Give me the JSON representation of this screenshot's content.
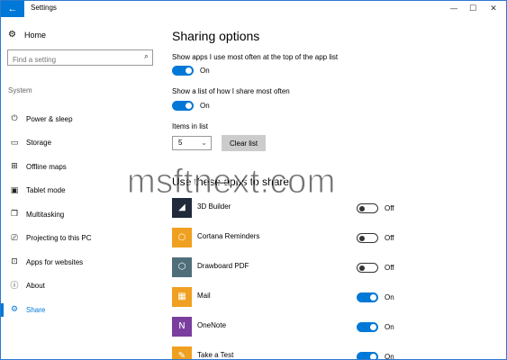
{
  "window": {
    "title": "Settings",
    "back_glyph": "←",
    "minimize_glyph": "—",
    "maximize_glyph": "☐",
    "close_glyph": "✕"
  },
  "sidebar": {
    "home_label": "Home",
    "search_placeholder": "Find a setting",
    "section_label": "System",
    "items": [
      {
        "label": "Power & sleep",
        "icon": "power-icon",
        "glyph": "⏻"
      },
      {
        "label": "Storage",
        "icon": "storage-icon",
        "glyph": "▭"
      },
      {
        "label": "Offline maps",
        "icon": "map-icon",
        "glyph": "⊞"
      },
      {
        "label": "Tablet mode",
        "icon": "tablet-icon",
        "glyph": "▣"
      },
      {
        "label": "Multitasking",
        "icon": "multitasking-icon",
        "glyph": "❐"
      },
      {
        "label": "Projecting to this PC",
        "icon": "projecting-icon",
        "glyph": "⎚"
      },
      {
        "label": "Apps for websites",
        "icon": "apps-websites-icon",
        "glyph": "⊡"
      },
      {
        "label": "About",
        "icon": "info-icon",
        "glyph": "ⓘ"
      },
      {
        "label": "Share",
        "icon": "share-icon",
        "glyph": "⚙",
        "active": true
      }
    ]
  },
  "main": {
    "title": "Sharing options",
    "option1": {
      "label": "Show apps I use most often at the top of the app list",
      "state": "On"
    },
    "option2": {
      "label": "Show a list of how I share most often",
      "state": "On"
    },
    "items_in_list_label": "Items in list",
    "items_in_list_value": "5",
    "clear_button": "Clear list",
    "apps_heading": "Use these apps to share",
    "apps": [
      {
        "name": "3D Builder",
        "state": "Off",
        "color": "#1f2a3a",
        "glyph": "◢"
      },
      {
        "name": "Cortana Reminders",
        "state": "Off",
        "color": "#f0a020",
        "glyph": "○"
      },
      {
        "name": "Drawboard PDF",
        "state": "Off",
        "color": "#4f6e7a",
        "glyph": "⬡"
      },
      {
        "name": "Mail",
        "state": "On",
        "color": "#f0a020",
        "glyph": "▦"
      },
      {
        "name": "OneNote",
        "state": "On",
        "color": "#7a3e9e",
        "glyph": "N"
      },
      {
        "name": "Take a Test",
        "state": "On",
        "color": "#f0a020",
        "glyph": "✎"
      }
    ]
  },
  "watermark": "msftnext.com",
  "colors": {
    "accent": "#0078d7"
  }
}
